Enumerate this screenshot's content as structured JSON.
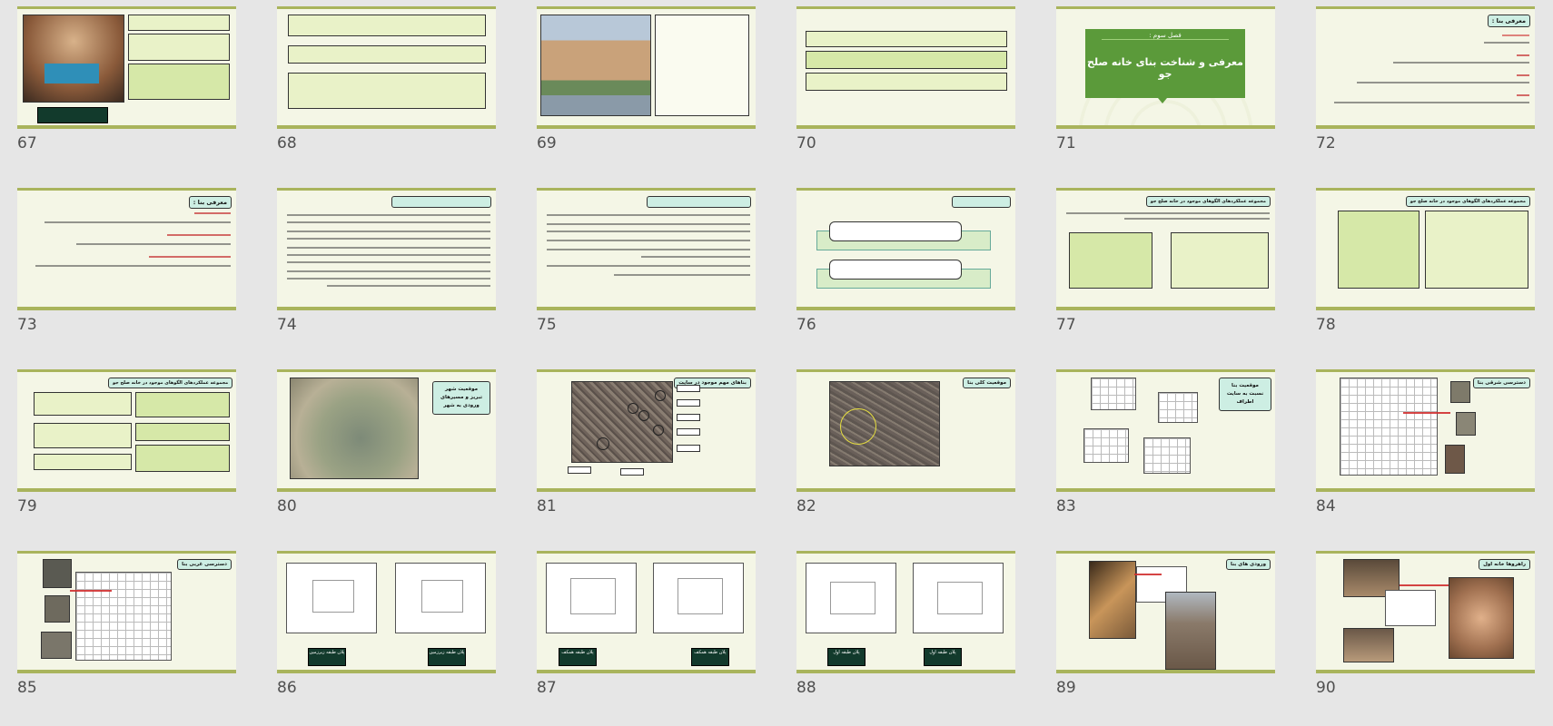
{
  "slides": [
    {
      "n": "67",
      "type": "photo_text"
    },
    {
      "n": "68",
      "type": "text_boxes"
    },
    {
      "n": "69",
      "type": "photo_text"
    },
    {
      "n": "70",
      "type": "text_boxes"
    },
    {
      "n": "71",
      "type": "chapter",
      "chapter_label": "فصل سوم :",
      "chapter_title": "معرفی و شناخت بنای خانه صلح جو"
    },
    {
      "n": "72",
      "type": "list",
      "title": "معرفی بنا :"
    },
    {
      "n": "73",
      "type": "list",
      "title": "معرفی بنا :"
    },
    {
      "n": "74",
      "type": "text_page"
    },
    {
      "n": "75",
      "type": "text_page"
    },
    {
      "n": "76",
      "type": "question"
    },
    {
      "n": "77",
      "type": "two_boxes",
      "title": "مجموعه عملکردهای الگوهای موجود در خانه صلح جو"
    },
    {
      "n": "78",
      "type": "two_boxes",
      "title": "مجموعه عملکردهای الگوهای موجود در خانه صلح جو"
    },
    {
      "n": "79",
      "type": "multi_boxes",
      "title": "مجموعه عملکردهای الگوهای موجود در خانه صلح جو"
    },
    {
      "n": "80",
      "type": "map",
      "title": "موقعیت شهر تبریز و مسیرهای ورودی به شهر"
    },
    {
      "n": "81",
      "type": "map_labels",
      "title": "بناهای مهم موجود در سایت"
    },
    {
      "n": "82",
      "type": "map_circle",
      "title": "موقعیت کلی بنا"
    },
    {
      "n": "83",
      "type": "plans",
      "title": "موقعیت بنا نسبت به سایت اطراف"
    },
    {
      "n": "84",
      "type": "plan_photos",
      "title": "دسترسی شرقی بنا"
    },
    {
      "n": "85",
      "type": "plan_photos",
      "title": "دسترسی غربی بنا"
    },
    {
      "n": "86",
      "type": "two_plans",
      "captions": [
        "پلان طبقه زیرزمین",
        "پلان طبقه زیرزمین"
      ]
    },
    {
      "n": "87",
      "type": "two_plans",
      "captions": [
        "پلان طبقه همکف",
        "پلان طبقه همکف"
      ]
    },
    {
      "n": "88",
      "type": "two_plans",
      "captions": [
        "پلان طبقه اول",
        "پلان طبقه اول"
      ]
    },
    {
      "n": "89",
      "type": "photos_plan",
      "title": "ورودی های بنا"
    },
    {
      "n": "90",
      "type": "photos_plan",
      "title": "راهروها خانه اول"
    }
  ],
  "colors": {
    "background": "#e6e6e6",
    "slide_bg": "#f4f6e6",
    "slide_border": "#a9b45c",
    "title_bg": "#cdeee3",
    "chapter_green": "#5b9a3a"
  }
}
